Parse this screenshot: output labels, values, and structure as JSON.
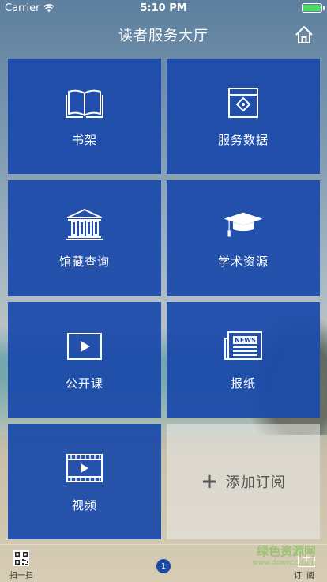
{
  "status_bar": {
    "carrier": "Carrier",
    "time": "5:10 PM"
  },
  "nav": {
    "title": "读者服务大厅",
    "home_icon": "home-icon"
  },
  "tiles": [
    {
      "label": "书架",
      "icon": "book-icon"
    },
    {
      "label": "服务数据",
      "icon": "data-icon"
    },
    {
      "label": "馆藏查询",
      "icon": "library-building-icon"
    },
    {
      "label": "学术资源",
      "icon": "graduation-cap-icon"
    },
    {
      "label": "公开课",
      "icon": "play-icon"
    },
    {
      "label": "报纸",
      "icon": "newspaper-icon"
    },
    {
      "label": "视频",
      "icon": "film-icon"
    }
  ],
  "add_subscription": {
    "plus": "+",
    "label": "添加订阅"
  },
  "tabbar": {
    "scan_label": "扫一扫",
    "page_indicator": "1",
    "subscribe_label": "订阅",
    "subscribe_symbol": "+"
  },
  "watermark": {
    "text": "绿色资源网",
    "url": "www.downcc.com"
  },
  "colors": {
    "tile": "#1a49aa",
    "accent_green": "#4cd964"
  }
}
